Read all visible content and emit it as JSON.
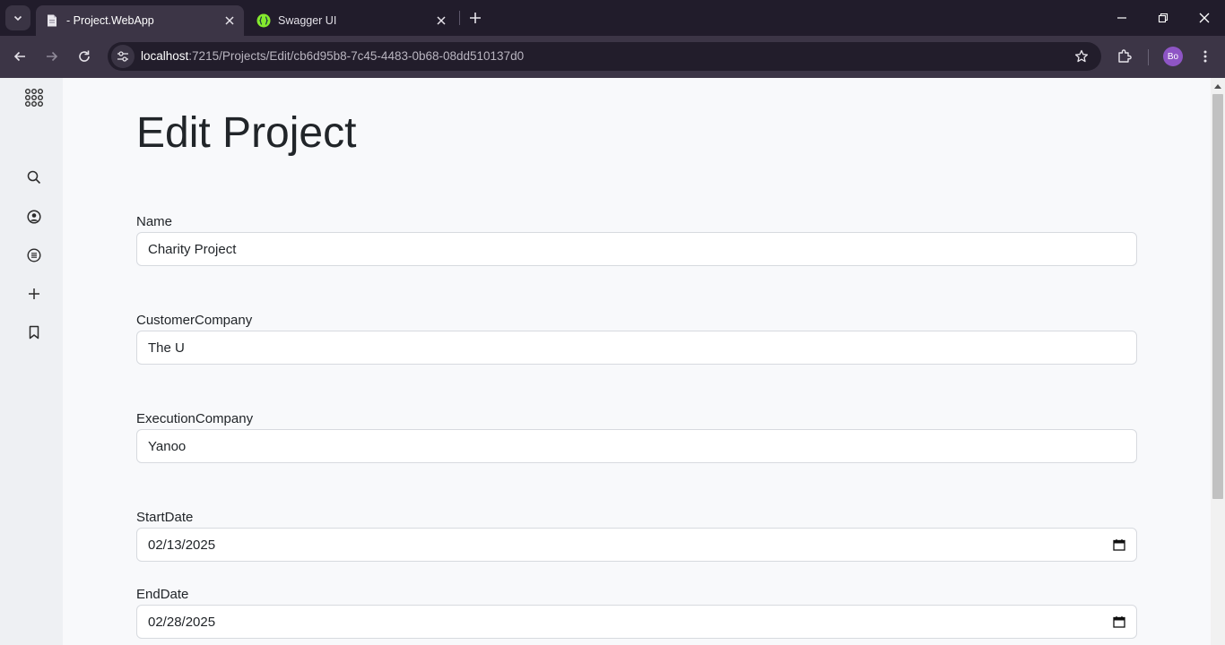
{
  "browser": {
    "tabs": [
      {
        "title": "- Project.WebApp",
        "active": true,
        "favicon": "page-icon"
      },
      {
        "title": "Swagger UI",
        "active": false,
        "favicon": "swagger-icon"
      }
    ],
    "url_host": "localhost",
    "url_rest": ":7215/Projects/Edit/cb6d95b8-7c45-4483-0b68-08dd510137d0",
    "profile_initials": "Bo",
    "colors": {
      "tabbar": "#211c2b",
      "toolbar": "#3c3546",
      "omnibox": "#221d2b",
      "profile": "#8e55c5",
      "swagger": "#85ea2d"
    }
  },
  "sidebar": {
    "icons": [
      "apps-grid-icon",
      "search-icon",
      "account-icon",
      "list-icon",
      "plus-icon",
      "bookmark-icon"
    ]
  },
  "page": {
    "title": "Edit Project",
    "fields": {
      "name": {
        "label": "Name",
        "value": "Charity Project"
      },
      "customer": {
        "label": "CustomerCompany",
        "value": "The U"
      },
      "execution": {
        "label": "ExecutionCompany",
        "value": "Yanoo"
      },
      "start": {
        "label": "StartDate",
        "value": "02/13/2025"
      },
      "end": {
        "label": "EndDate",
        "value": "02/28/2025"
      }
    }
  }
}
